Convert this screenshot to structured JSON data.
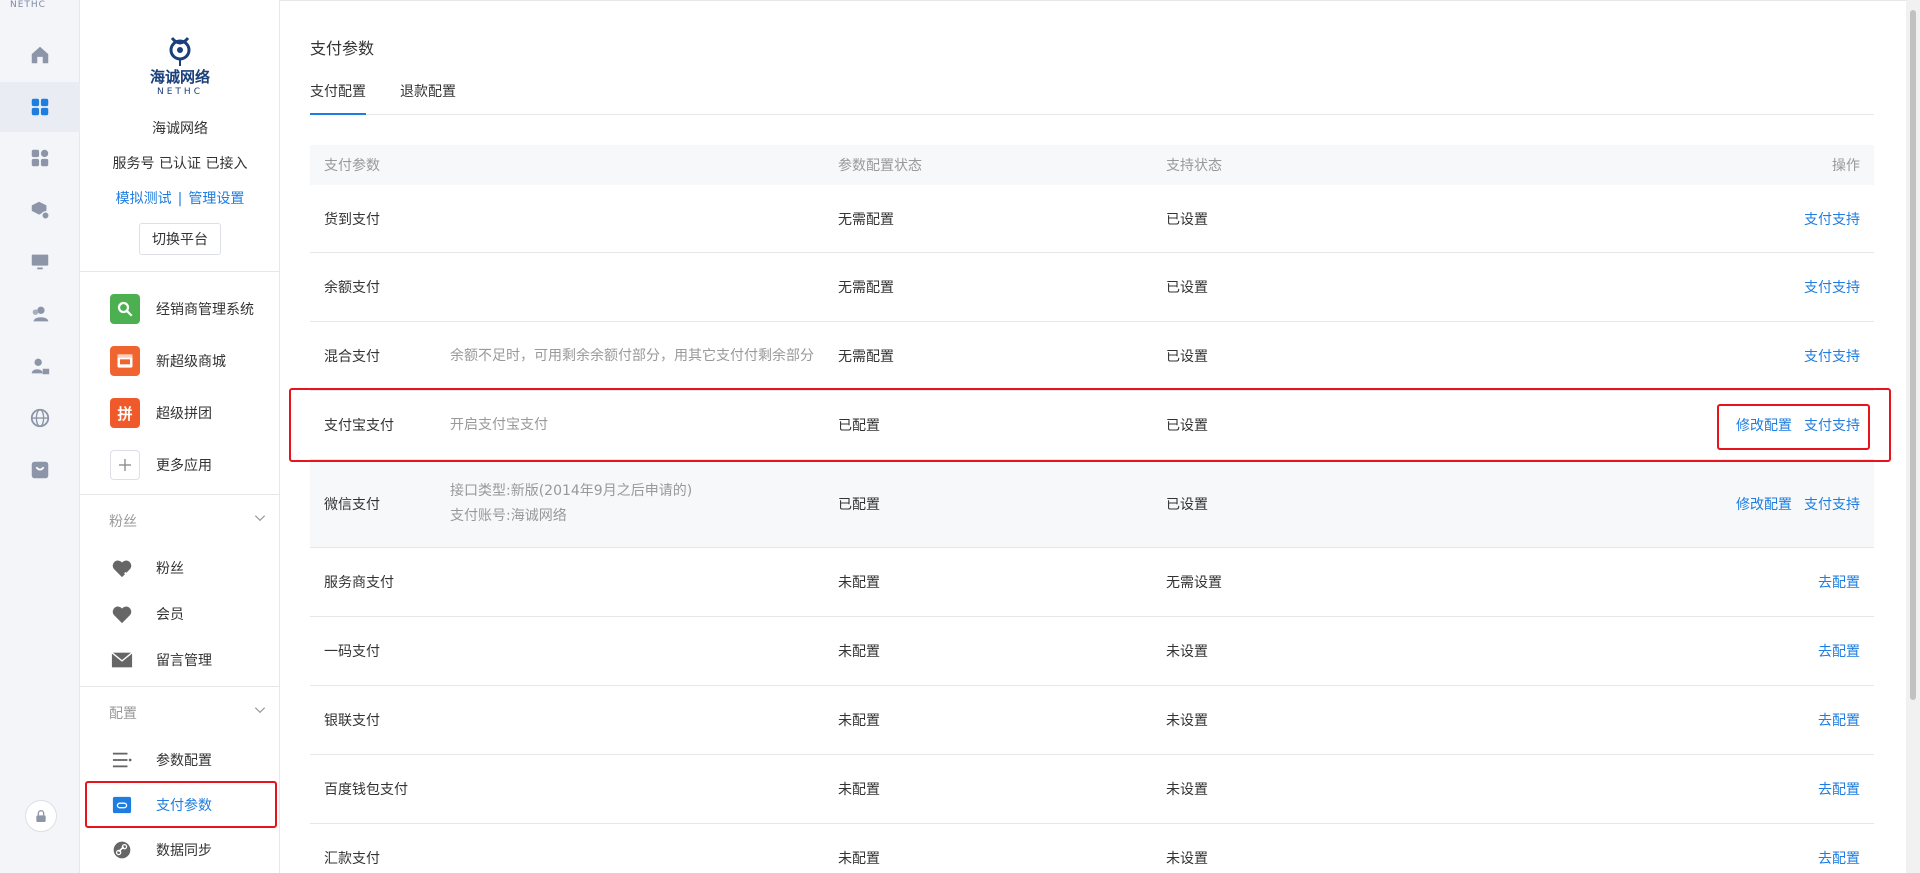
{
  "rail": {
    "top_mark": "NETHC",
    "items": [
      "home-icon",
      "dashboard-icon",
      "apps-icon",
      "box-settings-icon",
      "monitor-icon",
      "users-icon",
      "user-lock-icon",
      "globe-icon",
      "store-icon"
    ],
    "lock_icon": "lock-icon"
  },
  "account": {
    "logo_text": "海诚网络",
    "logo_sub": "NETHC",
    "name": "海诚网络",
    "status": "服务号 已认证 已接入",
    "link_test": "模拟测试",
    "link_sep": "|",
    "link_manage": "管理设置",
    "switch_label": "切换平台"
  },
  "apps": [
    {
      "label": "经销商管理系统",
      "icon": "dealer-icon",
      "color": "#4caf50"
    },
    {
      "label": "新超级商城",
      "icon": "mall-icon",
      "color": "#f06430"
    },
    {
      "label": "超级拼团",
      "icon": "group-buy-icon",
      "color": "#f05a2a",
      "glyph": "拼"
    },
    {
      "label": "更多应用",
      "icon": "plus-icon",
      "color": ""
    }
  ],
  "groups": {
    "fans": {
      "title": "粉丝",
      "items": [
        {
          "label": "粉丝",
          "icon": "heart-check-icon"
        },
        {
          "label": "会员",
          "icon": "heart-icon"
        },
        {
          "label": "留言管理",
          "icon": "mail-icon"
        }
      ]
    },
    "config": {
      "title": "配置",
      "items": [
        {
          "label": "参数配置",
          "icon": "list-icon"
        },
        {
          "label": "支付参数",
          "icon": "payment-card-icon"
        },
        {
          "label": "数据同步",
          "icon": "link-icon"
        }
      ]
    }
  },
  "main": {
    "title": "支付参数",
    "tabs": [
      "支付配置",
      "退款配置"
    ],
    "columns": [
      "支付参数",
      "参数配置状态",
      "支持状态",
      "操作"
    ],
    "rows": [
      {
        "name": "货到支付",
        "desc": [],
        "config": "无需配置",
        "support": "已设置",
        "actions": [
          "支付支持"
        ]
      },
      {
        "name": "余额支付",
        "desc": [],
        "config": "无需配置",
        "support": "已设置",
        "actions": [
          "支付支持"
        ]
      },
      {
        "name": "混合支付",
        "desc": [
          "余额不足时，可用剩余余额付部分，用其它支付付剩余部分"
        ],
        "config": "无需配置",
        "support": "已设置",
        "actions": [
          "支付支持"
        ]
      },
      {
        "name": "支付宝支付",
        "desc": [
          "开启支付宝支付"
        ],
        "config": "已配置",
        "support": "已设置",
        "actions": [
          "修改配置",
          "支付支持"
        ]
      },
      {
        "name": "微信支付",
        "desc": [
          "接口类型:新版(2014年9月之后申请的)",
          "支付账号:海诚网络"
        ],
        "config": "已配置",
        "support": "已设置",
        "actions": [
          "修改配置",
          "支付支持"
        ]
      },
      {
        "name": "服务商支付",
        "desc": [],
        "config": "未配置",
        "support": "无需设置",
        "actions": [
          "去配置"
        ]
      },
      {
        "name": "一码支付",
        "desc": [],
        "config": "未配置",
        "support": "未设置",
        "actions": [
          "去配置"
        ]
      },
      {
        "name": "银联支付",
        "desc": [],
        "config": "未配置",
        "support": "未设置",
        "actions": [
          "去配置"
        ]
      },
      {
        "name": "百度钱包支付",
        "desc": [],
        "config": "未配置",
        "support": "未设置",
        "actions": [
          "去配置"
        ]
      },
      {
        "name": "汇款支付",
        "desc": [],
        "config": "未配置",
        "support": "未设置",
        "actions": [
          "去配置"
        ]
      }
    ]
  },
  "colors": {
    "accent": "#1e7de0",
    "highlight": "#e8141b",
    "row_highlight": "#f6f8f9"
  }
}
